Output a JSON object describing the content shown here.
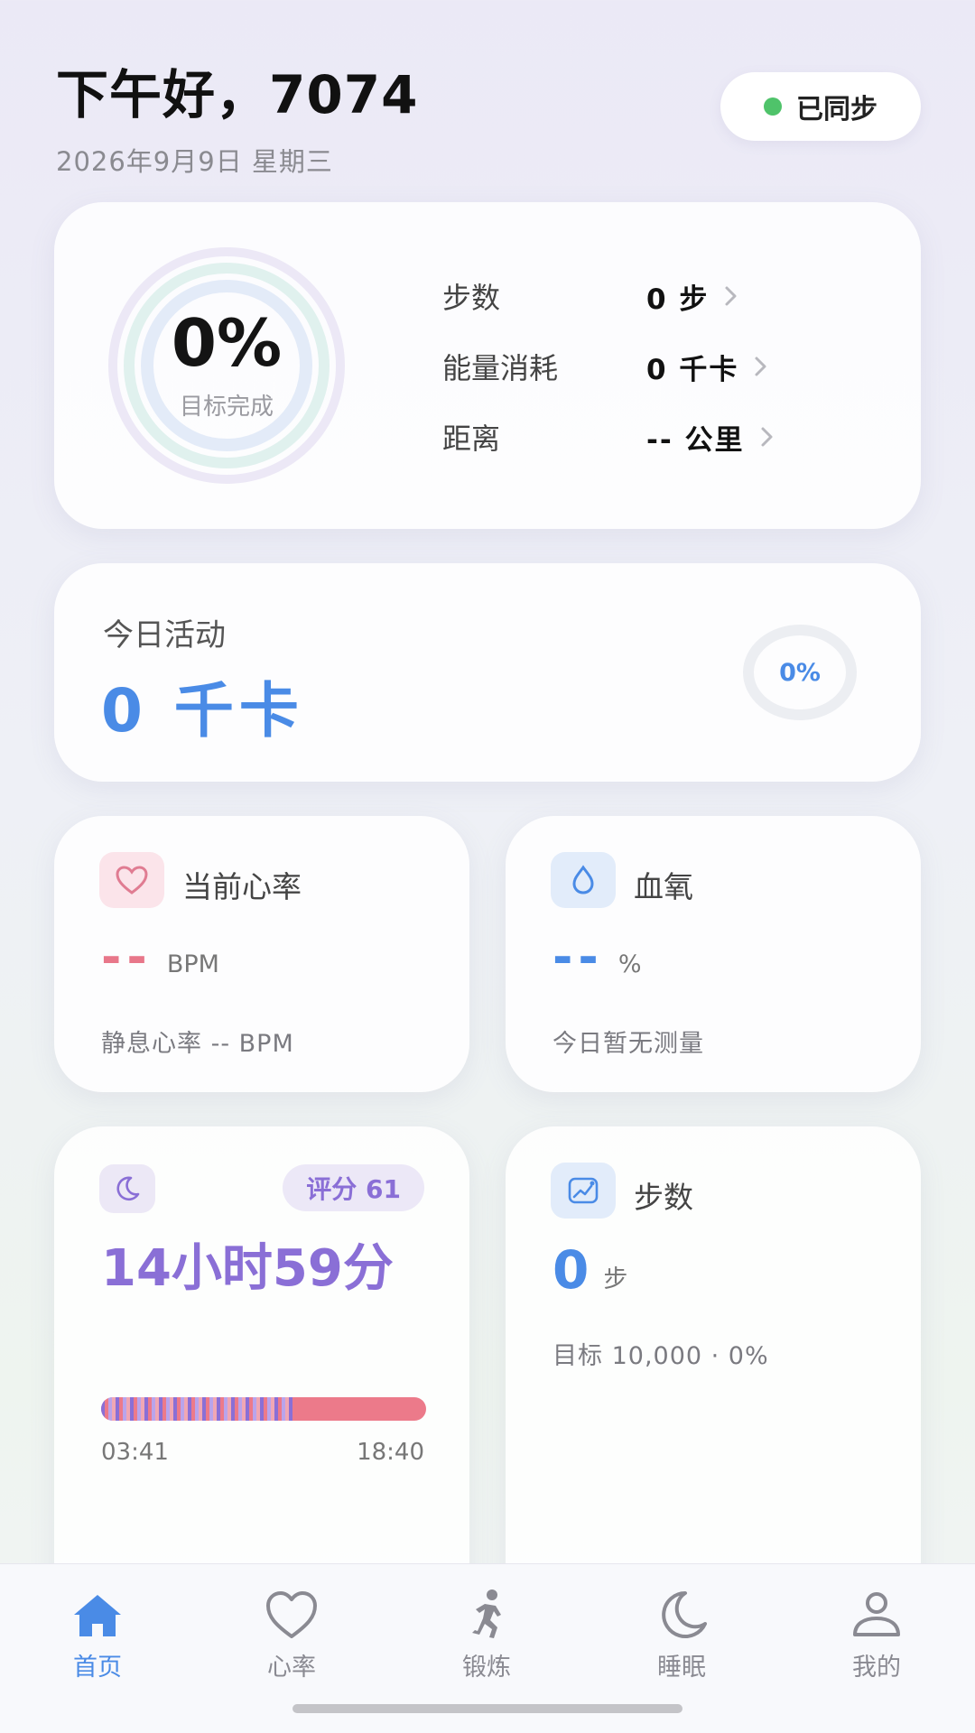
{
  "header": {
    "greeting": "下午好，7074",
    "date": "2026年9月9日 星期三",
    "sync_status": "已同步"
  },
  "goal_card": {
    "percent": "0%",
    "label": "目标完成",
    "progress": 0,
    "stats": [
      {
        "label": "步数",
        "value": "0 步"
      },
      {
        "label": "能量消耗",
        "value": "0 千卡"
      },
      {
        "label": "距离",
        "value": "-- 公里"
      }
    ]
  },
  "activity_card": {
    "label": "今日活动",
    "value": "0 千卡",
    "percent": "0%"
  },
  "heart_rate_card": {
    "title": "当前心率",
    "value": "--",
    "unit": "BPM",
    "sub": "静息心率 -- BPM",
    "color": "#e8778a"
  },
  "spo2_card": {
    "title": "血氧",
    "value": "--",
    "unit": "%",
    "sub": "今日暂无测量",
    "color": "#4a8be6"
  },
  "sleep_card": {
    "score": "评分 61",
    "duration": "14小时59分",
    "start_time": "03:41",
    "end_time": "18:40",
    "striped_fraction": 0.6,
    "color": "#8a6fd6"
  },
  "steps_card": {
    "title": "步数",
    "value": "0",
    "unit": "步",
    "goal": "目标 10,000 · 0%"
  },
  "tabbar": {
    "items": [
      {
        "label": "首页",
        "icon": "home-icon",
        "active": true
      },
      {
        "label": "心率",
        "icon": "heart-icon",
        "active": false
      },
      {
        "label": "锻炼",
        "icon": "running-icon",
        "active": false
      },
      {
        "label": "睡眠",
        "icon": "moon-icon",
        "active": false
      },
      {
        "label": "我的",
        "icon": "user-icon",
        "active": false
      }
    ],
    "active_color": "#4a8be6",
    "inactive_color": "#8a8a92"
  }
}
